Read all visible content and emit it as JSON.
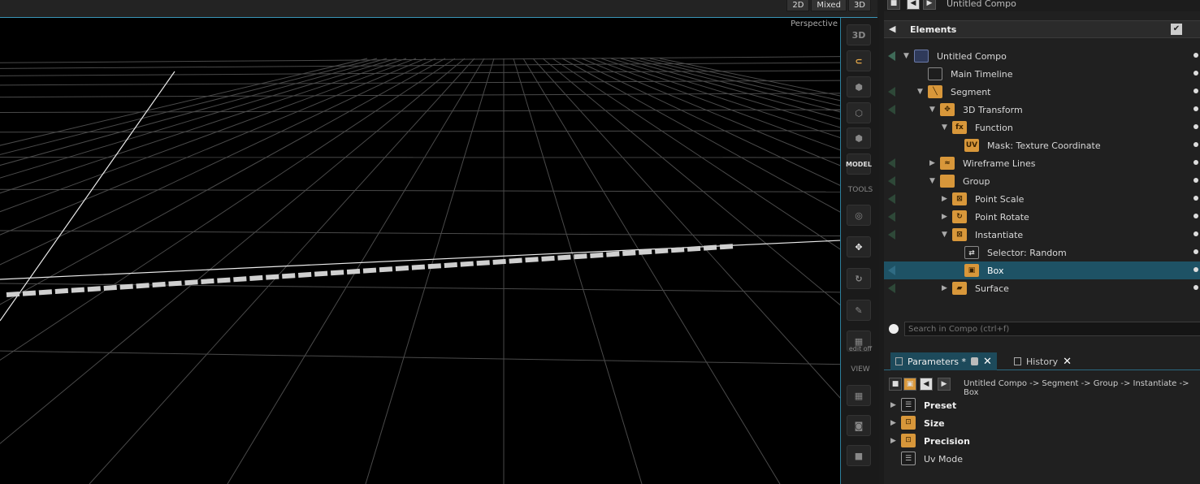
{
  "view_modes": [
    "2D",
    "Mixed",
    "3D"
  ],
  "viewport": {
    "camera_label": "Perspective"
  },
  "tools": {
    "button_3d": "3D",
    "model_label": "MODEL",
    "tools_label": "TOOLS",
    "edit_label": "edit off",
    "view_label": "VIEW"
  },
  "compo_title": "Untitled Compo",
  "elements_panel": {
    "title": "Elements"
  },
  "tree": [
    {
      "label": "Untitled Compo",
      "icon": "compo-icon"
    },
    {
      "label": "Main Timeline",
      "icon": "timeline-icon"
    },
    {
      "label": "Segment",
      "icon": "segment-icon"
    },
    {
      "label": "3D Transform",
      "icon": "transform-icon"
    },
    {
      "label": "Function",
      "icon": "fx-icon"
    },
    {
      "label": "Mask: Texture Coordinate",
      "icon": "uv-icon"
    },
    {
      "label": "Wireframe Lines",
      "icon": "wireframe-icon"
    },
    {
      "label": "Group",
      "icon": "folder-icon"
    },
    {
      "label": "Point Scale",
      "icon": "point-scale-icon"
    },
    {
      "label": "Point Rotate",
      "icon": "point-rotate-icon"
    },
    {
      "label": "Instantiate",
      "icon": "instantiate-icon"
    },
    {
      "label": "Selector: Random",
      "icon": "selector-icon"
    },
    {
      "label": "Box",
      "icon": "box-icon"
    },
    {
      "label": "Surface",
      "icon": "surface-icon"
    }
  ],
  "search": {
    "placeholder": "Search in Compo (ctrl+f)"
  },
  "tabs": {
    "parameters": "Parameters *",
    "history": "History"
  },
  "breadcrumb": "Untitled Compo -> Segment -> Group -> Instantiate -> Box",
  "params": [
    {
      "label": "Preset",
      "icon": "preset-icon"
    },
    {
      "label": "Size",
      "icon": "size-icon"
    },
    {
      "label": "Precision",
      "icon": "precision-icon"
    },
    {
      "label": "Uv Mode",
      "icon": "uv-mode-icon"
    }
  ],
  "colors": {
    "accent": "#3a95b8",
    "selection": "#1e5265",
    "icon_orange": "#d8973a"
  }
}
